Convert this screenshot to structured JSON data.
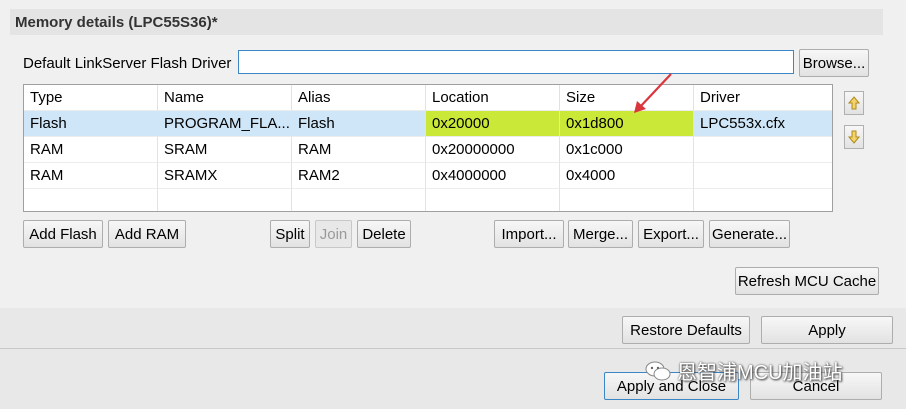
{
  "header": {
    "title": "Memory details (LPC55S36)*"
  },
  "flash_driver": {
    "label": "Default LinkServer Flash Driver",
    "value": "",
    "browse_label": "Browse..."
  },
  "table": {
    "columns": [
      "Type",
      "Name",
      "Alias",
      "Location",
      "Size",
      "Driver"
    ],
    "rows": [
      {
        "type": "Flash",
        "name": "PROGRAM_FLA...",
        "alias": "Flash",
        "location": "0x20000",
        "size": "0x1d800",
        "driver": "LPC553x.cfx",
        "selected": true
      },
      {
        "type": "RAM",
        "name": "SRAM",
        "alias": "RAM",
        "location": "0x20000000",
        "size": "0x1c000",
        "driver": ""
      },
      {
        "type": "RAM",
        "name": "SRAMX",
        "alias": "RAM2",
        "location": "0x4000000",
        "size": "0x4000",
        "driver": ""
      }
    ]
  },
  "actions": {
    "add_flash": "Add Flash",
    "add_ram": "Add RAM",
    "split": "Split",
    "join": "Join",
    "delete": "Delete",
    "import": "Import...",
    "merge": "Merge...",
    "export": "Export...",
    "generate": "Generate...",
    "refresh": "Refresh MCU Cache"
  },
  "footer": {
    "restore_defaults": "Restore Defaults",
    "apply": "Apply",
    "apply_and_close": "Apply and Close",
    "cancel": "Cancel"
  },
  "watermark": {
    "text": "恩智浦MCU加油站",
    "icon": "wechat-icon"
  },
  "annotation": {
    "icon": "red-arrow-icon",
    "color": "#d9363e"
  },
  "colors": {
    "highlight": "#c9e838",
    "selection": "#cfe6f8",
    "focus_border": "#3d86c6"
  }
}
